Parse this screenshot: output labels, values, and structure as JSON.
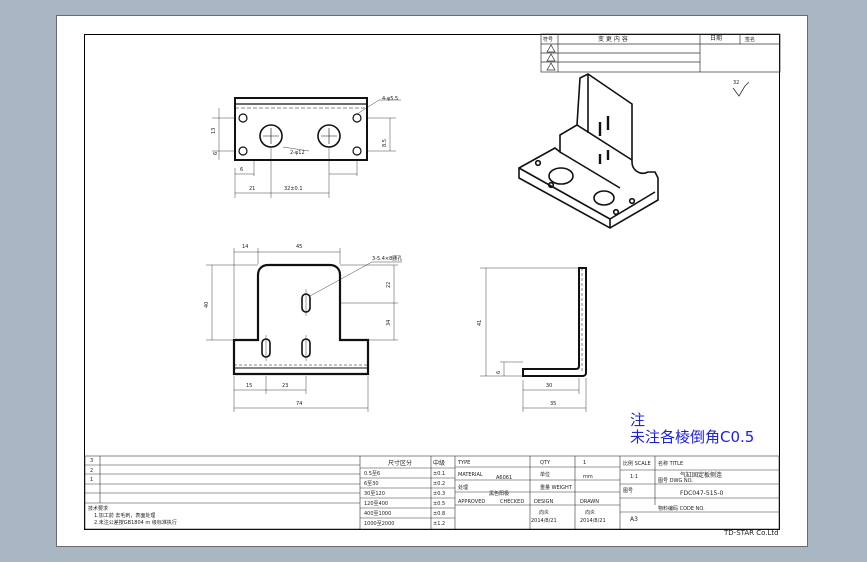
{
  "window": {
    "background": "#a9b6c4",
    "sheet_color": "#ffffff"
  },
  "revision_table": {
    "headers": [
      "符号",
      "变 更 内 容",
      "日期",
      "签名"
    ],
    "rows": 3
  },
  "surface_finish": "32",
  "note": {
    "title": "注",
    "text": "未注各棱倒角C0.5"
  },
  "dimensions": {
    "top_view": [
      "4-φ5.5",
      "2-φ12",
      "13",
      "6",
      "6",
      "21",
      "32±0.1",
      "8.5"
    ],
    "front_view": [
      "14",
      "45",
      "3-5.4×8腰孔",
      "40",
      "22",
      "34",
      "15",
      "23",
      "74"
    ],
    "side_view": [
      "41",
      "6",
      "30",
      "35"
    ]
  },
  "title_block": {
    "tech_req_title": "技术要求",
    "tech_req_1": "1.加工前 去毛刺，表面处理",
    "tech_req_2": "2.未注公差按GB1804 m 级标准执行",
    "tolerance_header_1": "尺寸区分",
    "tolerance_header_2": "中级",
    "tolerance_rows": [
      [
        "0.5至6",
        "±0.1"
      ],
      [
        "6至30",
        "±0.2"
      ],
      [
        "30至120",
        "±0.3"
      ],
      [
        "120至400",
        "±0.5"
      ],
      [
        "400至1000",
        "±0.8"
      ],
      [
        "1000至2000",
        "±1.2"
      ]
    ],
    "type_label": "TYPE",
    "material_label": "MATERIAL",
    "material_value": "A6061",
    "treatment_label": "处理",
    "treatment_value": "黑色阳极",
    "approved_label": "APPROVED",
    "checked_label": "CHECKED",
    "designed_label": "DESIGN",
    "drawn_label": "DRAWN",
    "checker_name": "向炎",
    "drawer_name": "向炎",
    "date_1": "2014/8/21",
    "date_2": "2014/8/21",
    "qty_label": "QTY",
    "qty_value": "1",
    "unit_label": "单位",
    "unit_value": "mm",
    "weight_label": "重量 WEIGHT",
    "scale_label": "比例 SCALE",
    "scale_value": "1:1",
    "size_label": "图号",
    "size_value": "A3",
    "name_label": "名称 TITLE",
    "name_value": "气缸固定板侧连",
    "drawing_no_label": "图号 DWG NO.",
    "drawing_no_value": "FDC047-515-0",
    "code_label": "物料编码 CODE NO.",
    "company": "TD-STAR Co.Ltd"
  }
}
